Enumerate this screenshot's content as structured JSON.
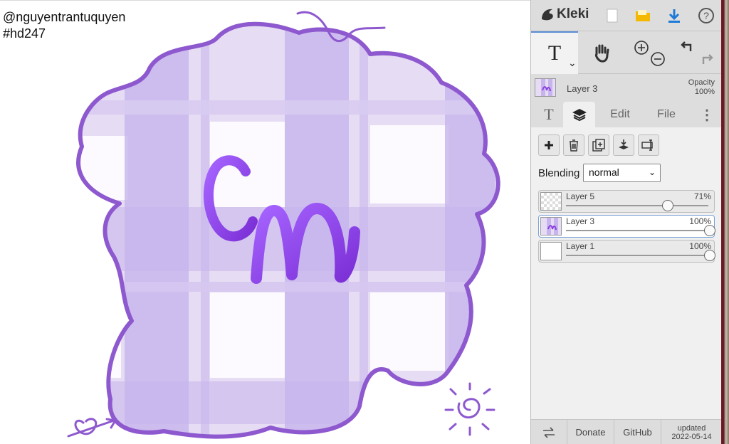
{
  "canvas": {
    "credit_line1": "@nguyentrantuquyen",
    "credit_line2": "#hd247",
    "colors": {
      "plaid_bg": "#e3d9f3",
      "plaid_stripe": "#c5b3ea",
      "outline": "#8e59cf",
      "letters": "#8a3fe0"
    }
  },
  "app": {
    "name": "Kleki",
    "logo_icon": "kleki-bird-icon",
    "top_buttons": [
      {
        "name": "new-image-icon"
      },
      {
        "name": "open-folder-icon"
      },
      {
        "name": "download-icon"
      },
      {
        "name": "help-icon"
      }
    ]
  },
  "tools": {
    "text_tool": "T",
    "text_tool_chevron": "⌄",
    "hand": "hand-icon",
    "zoom_in": "zoom-in-icon",
    "zoom_out": "zoom-out-icon",
    "undo": "undo-icon",
    "redo": "redo-icon"
  },
  "active_layer": {
    "name": "Layer 3",
    "opacity_label": "Opacity",
    "opacity_value": "100%"
  },
  "tabs": [
    {
      "label": "T",
      "icon": "text-tab-icon"
    },
    {
      "label": "",
      "icon": "layers-icon"
    },
    {
      "label": "Edit"
    },
    {
      "label": "File"
    },
    {
      "label": "⋮",
      "icon": "more-icon"
    }
  ],
  "layer_panel": {
    "buttons": [
      "add-layer-icon",
      "delete-layer-icon",
      "duplicate-layer-icon",
      "merge-down-icon",
      "rename-layer-icon"
    ],
    "blending_label": "Blending",
    "blending_value": "normal",
    "layers": [
      {
        "name": "Layer 5",
        "opacity": "71%",
        "opacity_value": 0.71,
        "selected": false
      },
      {
        "name": "Layer 3",
        "opacity": "100%",
        "opacity_value": 1.0,
        "selected": true
      },
      {
        "name": "Layer 1",
        "opacity": "100%",
        "opacity_value": 1.0,
        "selected": false
      }
    ]
  },
  "footer": {
    "swap_icon": "swap-sides-icon",
    "donate": "Donate",
    "github": "GitHub",
    "updated_label": "updated",
    "updated_date": "2022-05-14"
  }
}
